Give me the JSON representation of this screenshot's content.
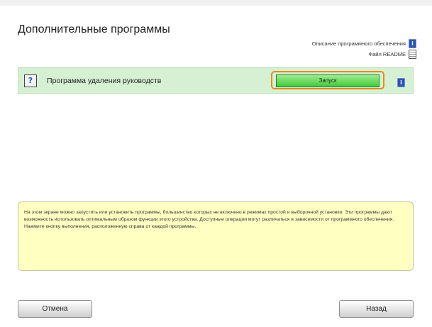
{
  "header": {
    "title": "Дополнительные программы",
    "links": [
      {
        "label": "Описание программного обеспечения",
        "icon": "info-icon"
      },
      {
        "label": "Файл README",
        "icon": "document-icon"
      }
    ]
  },
  "program": {
    "name": "Программа удаления руководств",
    "button_label": "Запуск",
    "icon": "uninstall-guide-icon",
    "info_icon": "info-icon"
  },
  "note": "На этом экране можно запустить или установить программы, большинство которых не включено в режимах простой и выборочной установки. Эти программы дают возможность использовать оптимальным образом функции этого устройства. Доступные операции могут различаться в зависимости от программного обеспечения. Нажмите кнопку выполнения, расположенную справа от каждой программы.",
  "footer": {
    "cancel_label": "Отмена",
    "back_label": "Назад"
  },
  "colors": {
    "row_bg": "#d5f0d2",
    "launch_button": "#46c939",
    "highlight": "#e88a1c",
    "note_bg": "#ffffc2"
  }
}
